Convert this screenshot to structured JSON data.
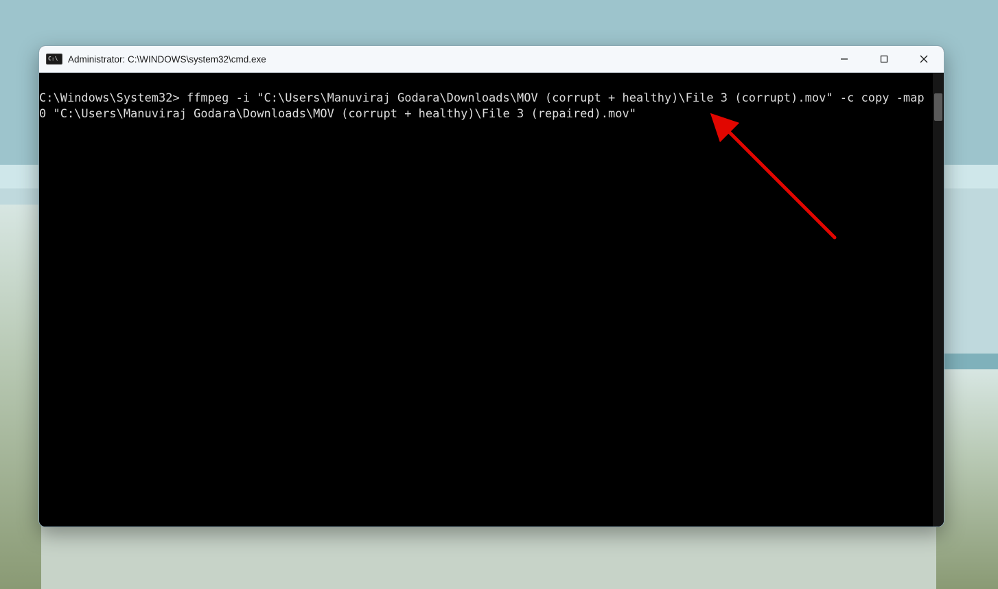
{
  "window": {
    "icon_text": "C:\\",
    "title": "Administrator: C:\\WINDOWS\\system32\\cmd.exe"
  },
  "terminal": {
    "prompt": "C:\\Windows\\System32>",
    "command": "ffmpeg -i \"C:\\Users\\Manuviraj Godara\\Downloads\\MOV (corrupt + healthy)\\File 3 (corrupt).mov\" -c copy -map 0 \"C:\\Users\\Manuviraj Godara\\Downloads\\MOV (corrupt + healthy)\\File 3 (repaired).mov\""
  }
}
